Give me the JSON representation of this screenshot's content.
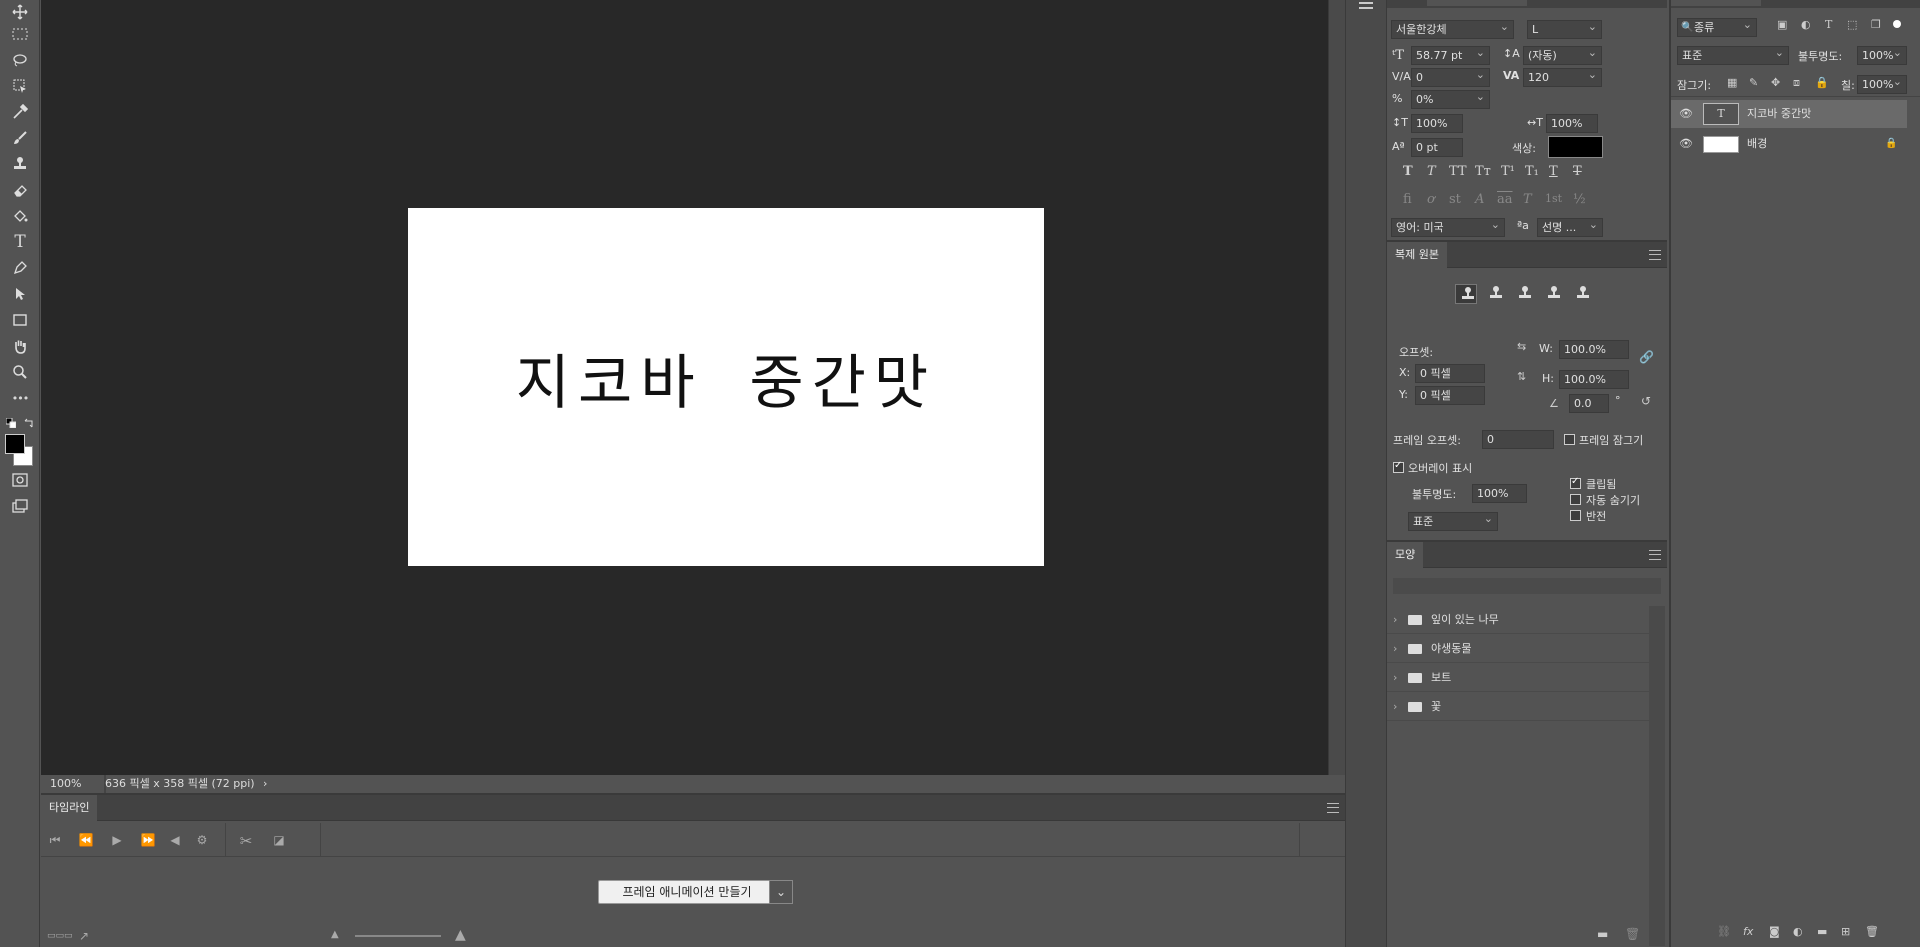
{
  "document": {
    "text": "지코바 중간맛",
    "zoom": "100%",
    "size_info": "636 픽셀 x 358 픽셀 (72 ppi)",
    "status_arrow": "›"
  },
  "toolbar": {
    "icons": [
      "move-icon",
      "marquee-icon",
      "lasso-icon",
      "object-select-icon",
      "eyedropper-icon",
      "brush-icon",
      "stamp-icon",
      "eraser-icon",
      "paint-bucket-icon",
      "type-icon",
      "pen-icon",
      "path-select-icon",
      "rectangle-icon",
      "hand-icon",
      "zoom-icon",
      "more-icon"
    ],
    "type_glyph": "T",
    "more_glyph": "•••"
  },
  "timeline": {
    "title": "타임라인",
    "make_animation": "프레임 애니메이션 만들기",
    "dropdown_glyph": "⌄"
  },
  "character": {
    "font_family": "서울한강체",
    "font_style": "L",
    "font_size": "58.77 pt",
    "leading": "(자동)",
    "kerning": "0",
    "tracking": "120",
    "tsume": "0%",
    "vertical_scale": "100%",
    "horizontal_scale": "100%",
    "baseline_shift": "0 pt",
    "color_label": "색상:",
    "color_value": "#000000",
    "style_buttons": [
      "T",
      "T",
      "TT",
      "Tт",
      "T¹",
      "T₁",
      "T",
      "T"
    ],
    "opentype_buttons": [
      "fi",
      "ơ",
      "st",
      "A",
      "aa",
      "T",
      "1st",
      "½"
    ],
    "language": "영어: 미국",
    "antialias": "선명 ...",
    "aa_glyph": "ªa"
  },
  "clone_source": {
    "title": "복제 원본",
    "offset_label": "오프셋:",
    "x_label": "X:",
    "x_value": "0 픽셀",
    "y_label": "Y:",
    "y_value": "0 픽셀",
    "w_label": "W:",
    "w_value": "100.0%",
    "h_label": "H:",
    "h_value": "100.0%",
    "angle_value": "0.0",
    "degree": "°",
    "frame_offset_label": "프레임 오프셋:",
    "frame_offset_value": "0",
    "lock_frame_label": "프레임 잠그기",
    "lock_frame_checked": false,
    "show_overlay_label": "오버레이 표시",
    "show_overlay_checked": true,
    "opacity_label": "불투명도:",
    "opacity_value": "100%",
    "mode_value": "표준",
    "clipped_label": "클립됨",
    "clipped_checked": true,
    "auto_hide_label": "자동 숨기기",
    "auto_hide_checked": false,
    "invert_label": "반전",
    "invert_checked": false
  },
  "shapes": {
    "title": "모양",
    "folders": [
      "잎이 있는 나무",
      "야생동물",
      "보트",
      "꽃"
    ]
  },
  "layers": {
    "filter_kind": "종류",
    "blend_mode": "표준",
    "opacity_label": "불투명도:",
    "opacity_value": "100%",
    "lock_label": "잠그기:",
    "fill_label": "칠:",
    "fill_value": "100%",
    "items": [
      {
        "name": "지코바 중간맛",
        "type": "text",
        "selected": true
      },
      {
        "name": "배경",
        "type": "background",
        "locked": true
      }
    ],
    "footer_icons": [
      "link-icon",
      "fx-icon",
      "mask-icon",
      "adjustment-icon",
      "group-icon",
      "new-layer-icon",
      "delete-icon"
    ],
    "fx_text": "fx"
  },
  "colors": {
    "ui_bg": "#535353",
    "canvas_bg": "#282828",
    "panel_dark": "#424242",
    "foreground": "#000000",
    "background": "#ffffff",
    "selected_layer": "#6a6a6a"
  }
}
